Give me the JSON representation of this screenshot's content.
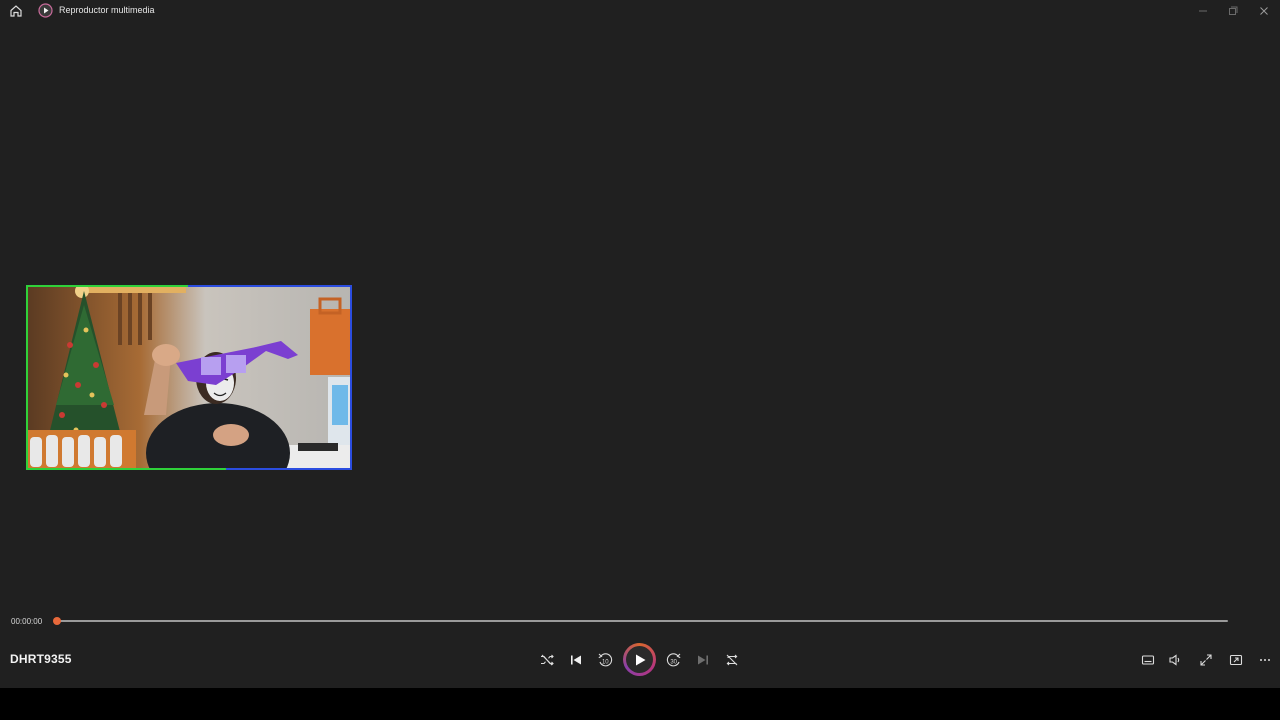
{
  "window": {
    "title": "Reproductor multimedia"
  },
  "playback": {
    "current_time": "00:00:00",
    "progress": 0.0,
    "media_title": "DHRT9355"
  },
  "colors": {
    "background": "#202020",
    "accent": "#e8693b",
    "play_gradient": [
      "#d8662f",
      "#b6357e",
      "#8a3fa8"
    ]
  },
  "icons": {
    "titlebar": [
      "home-icon",
      "media-player-app-icon",
      "minimize-icon",
      "maximize-icon",
      "close-icon"
    ],
    "transport": [
      "shuffle-icon",
      "previous-icon",
      "rewind-10-icon",
      "play-icon",
      "forward-30-icon",
      "next-icon",
      "repeat-off-icon"
    ],
    "right": [
      "subtitles-icon",
      "volume-icon",
      "fullscreen-icon",
      "mini-player-icon",
      "more-icon"
    ]
  },
  "transport": {
    "rewind_label": "10",
    "forward_label": "30"
  }
}
